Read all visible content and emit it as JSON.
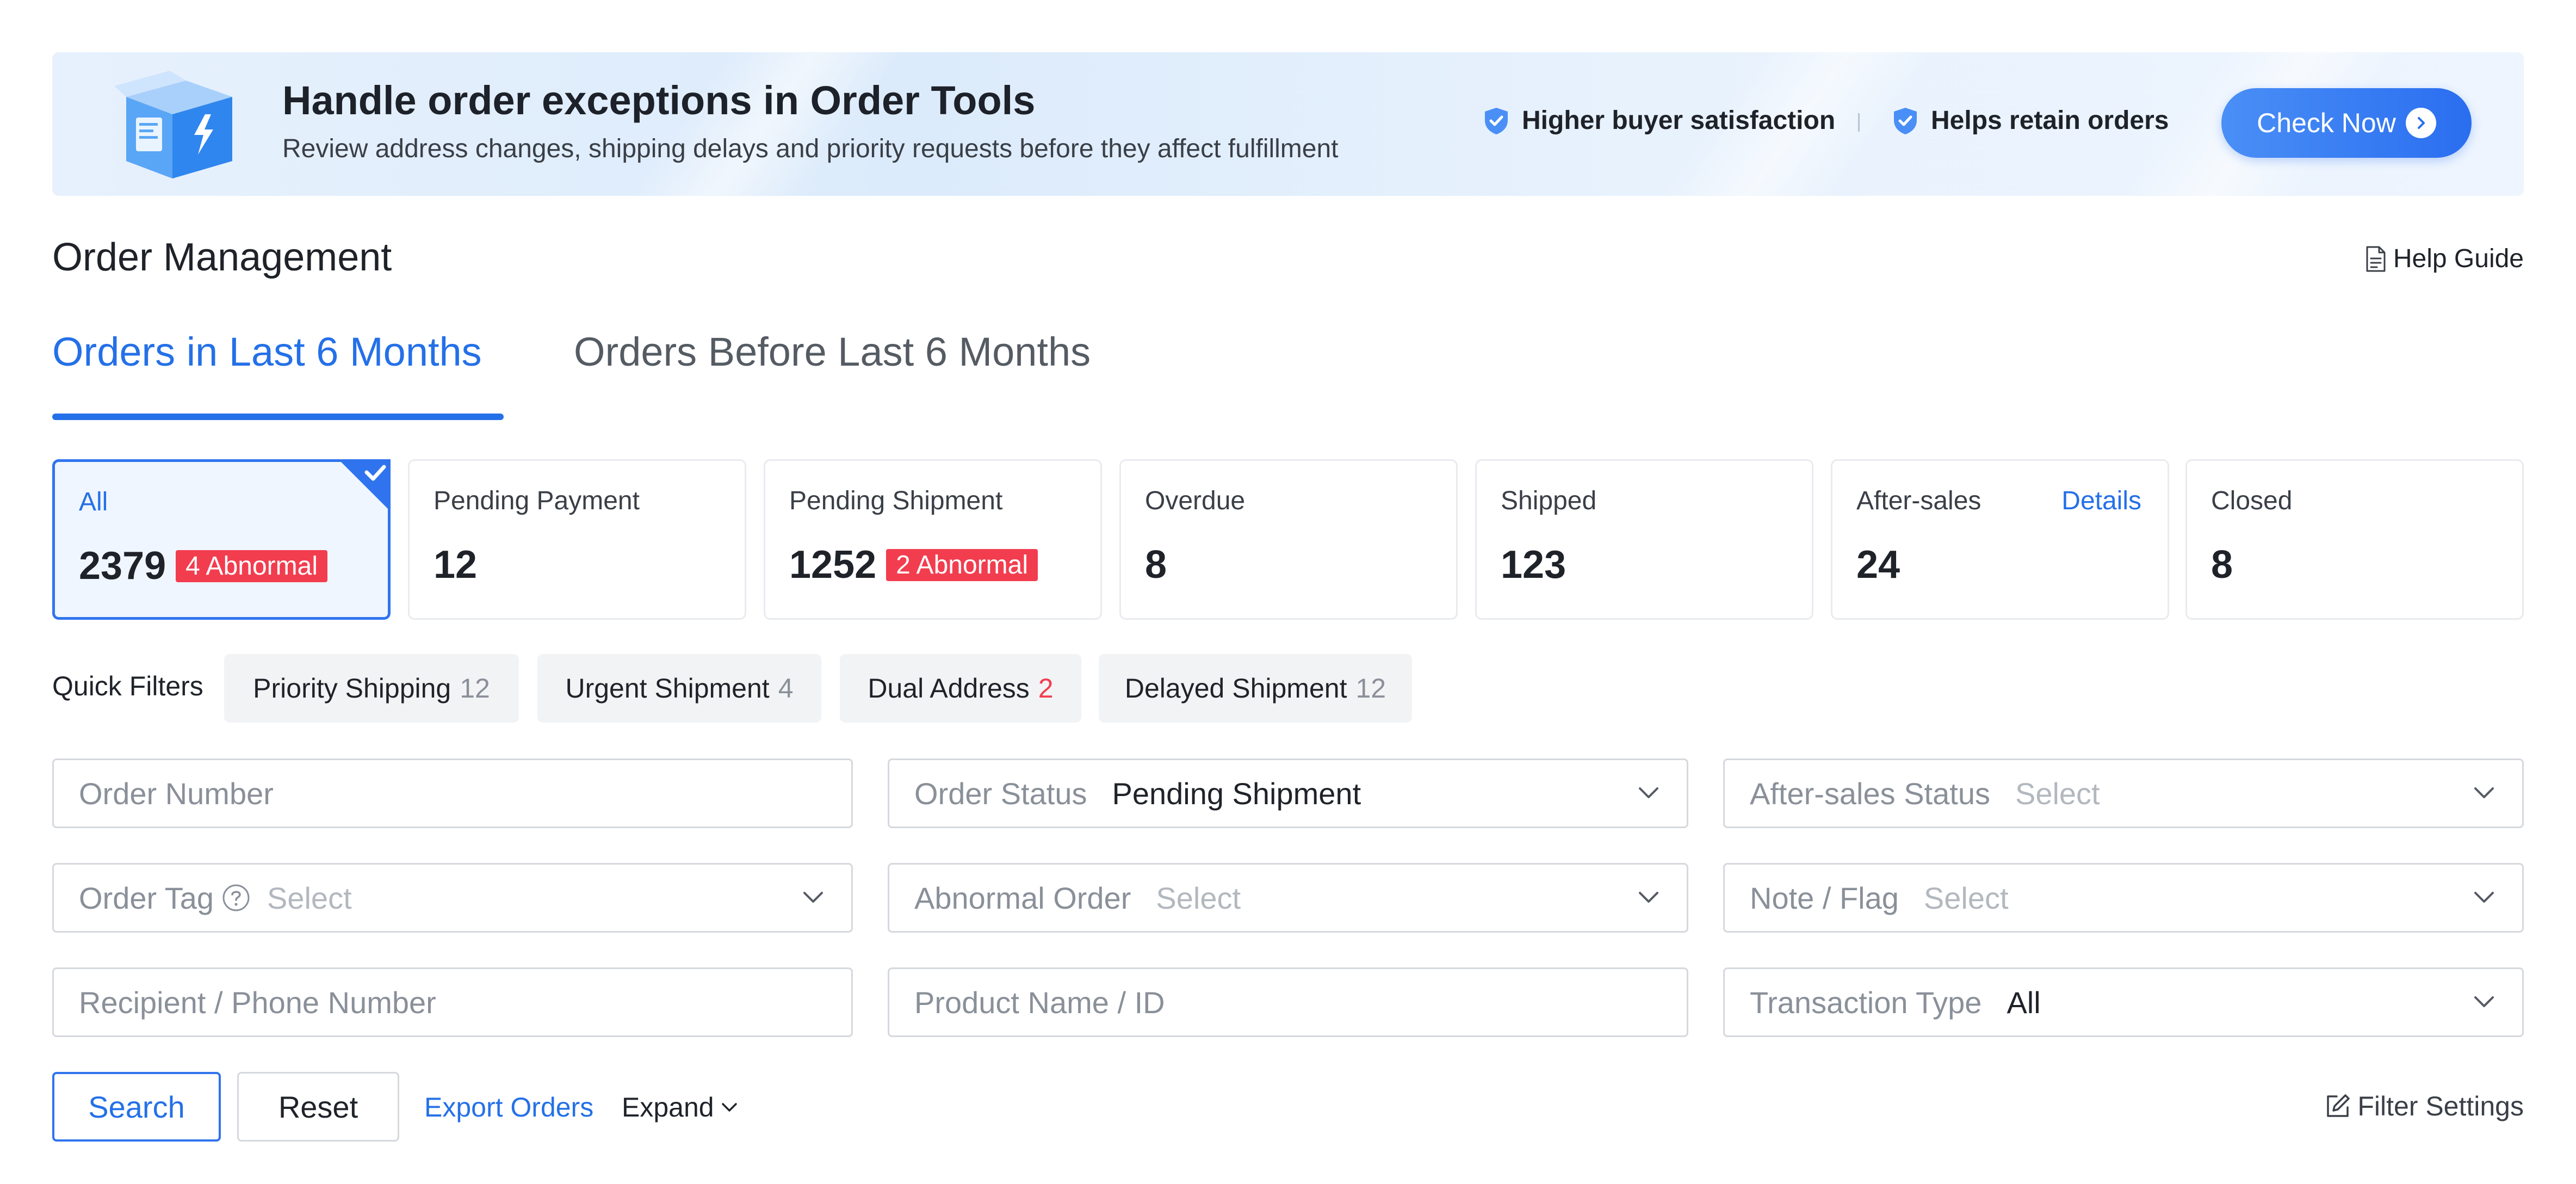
{
  "banner": {
    "title": "Handle order exceptions in Order Tools",
    "description": "Review address changes, shipping delays and priority requests before they affect fulfillment",
    "benefits": [
      "Higher buyer satisfaction",
      "Helps retain orders"
    ],
    "cta_label": "Check Now",
    "accent_color": "#2a6ef0"
  },
  "header": {
    "title": "Order Management",
    "help_label": "Help Guide"
  },
  "tabs": [
    {
      "label": "Orders in Last 6 Months",
      "active": true
    },
    {
      "label": "Orders Before Last 6 Months",
      "active": false
    }
  ],
  "status_cards": [
    {
      "label": "All",
      "count": "2379",
      "badge": "4 Abnormal",
      "selected": true
    },
    {
      "label": "Pending Payment",
      "count": "12"
    },
    {
      "label": "Pending Shipment",
      "count": "1252",
      "badge": "2 Abnormal"
    },
    {
      "label": "Overdue",
      "count": "8"
    },
    {
      "label": "Shipped",
      "count": "123"
    },
    {
      "label": "After-sales",
      "count": "24",
      "link": "Details"
    },
    {
      "label": "Closed",
      "count": "8"
    }
  ],
  "quick_filters": {
    "label": "Quick Filters",
    "chips": [
      {
        "label": "Priority Shipping",
        "count": "12"
      },
      {
        "label": "Urgent Shipment",
        "count": "4"
      },
      {
        "label": "Dual Address",
        "count": "2",
        "highlight": "#f23d4f"
      },
      {
        "label": "Delayed Shipment",
        "count": "12"
      }
    ]
  },
  "form": {
    "order_number": {
      "placeholder": "Order Number"
    },
    "order_status": {
      "label": "Order Status",
      "value": "Pending Shipment"
    },
    "after_sales_status": {
      "label": "After-sales Status",
      "placeholder": "Select"
    },
    "order_tag": {
      "label": "Order Tag",
      "placeholder": "Select"
    },
    "abnormal_order": {
      "label": "Abnormal Order",
      "placeholder": "Select"
    },
    "note_flag": {
      "label": "Note / Flag",
      "placeholder": "Select"
    },
    "recipient": {
      "placeholder": "Recipient / Phone Number"
    },
    "product": {
      "placeholder": "Product Name / ID"
    },
    "transaction_type": {
      "label": "Transaction Type",
      "value": "All"
    }
  },
  "actions": {
    "search_label": "Search",
    "reset_label": "Reset",
    "export_label": "Export Orders",
    "expand_label": "Expand",
    "filter_settings_label": "Filter Settings"
  }
}
